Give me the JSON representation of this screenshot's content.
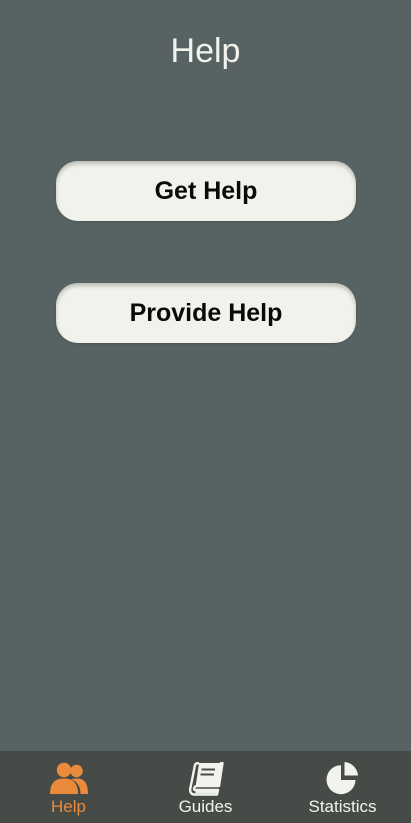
{
  "header": {
    "title": "Help"
  },
  "actions": {
    "get_help_label": "Get Help",
    "provide_help_label": "Provide Help"
  },
  "bottom_nav": {
    "items": [
      {
        "label": "Help",
        "icon": "people-icon",
        "active": true
      },
      {
        "label": "Guides",
        "icon": "book-icon",
        "active": false
      },
      {
        "label": "Statistics",
        "icon": "pie-chart-icon",
        "active": false
      }
    ]
  },
  "colors": {
    "background": "#576362",
    "nav_background": "#464b47",
    "button_background": "#f2f2ec",
    "active": "#ea8a3c",
    "inactive": "#f3f3ee"
  }
}
